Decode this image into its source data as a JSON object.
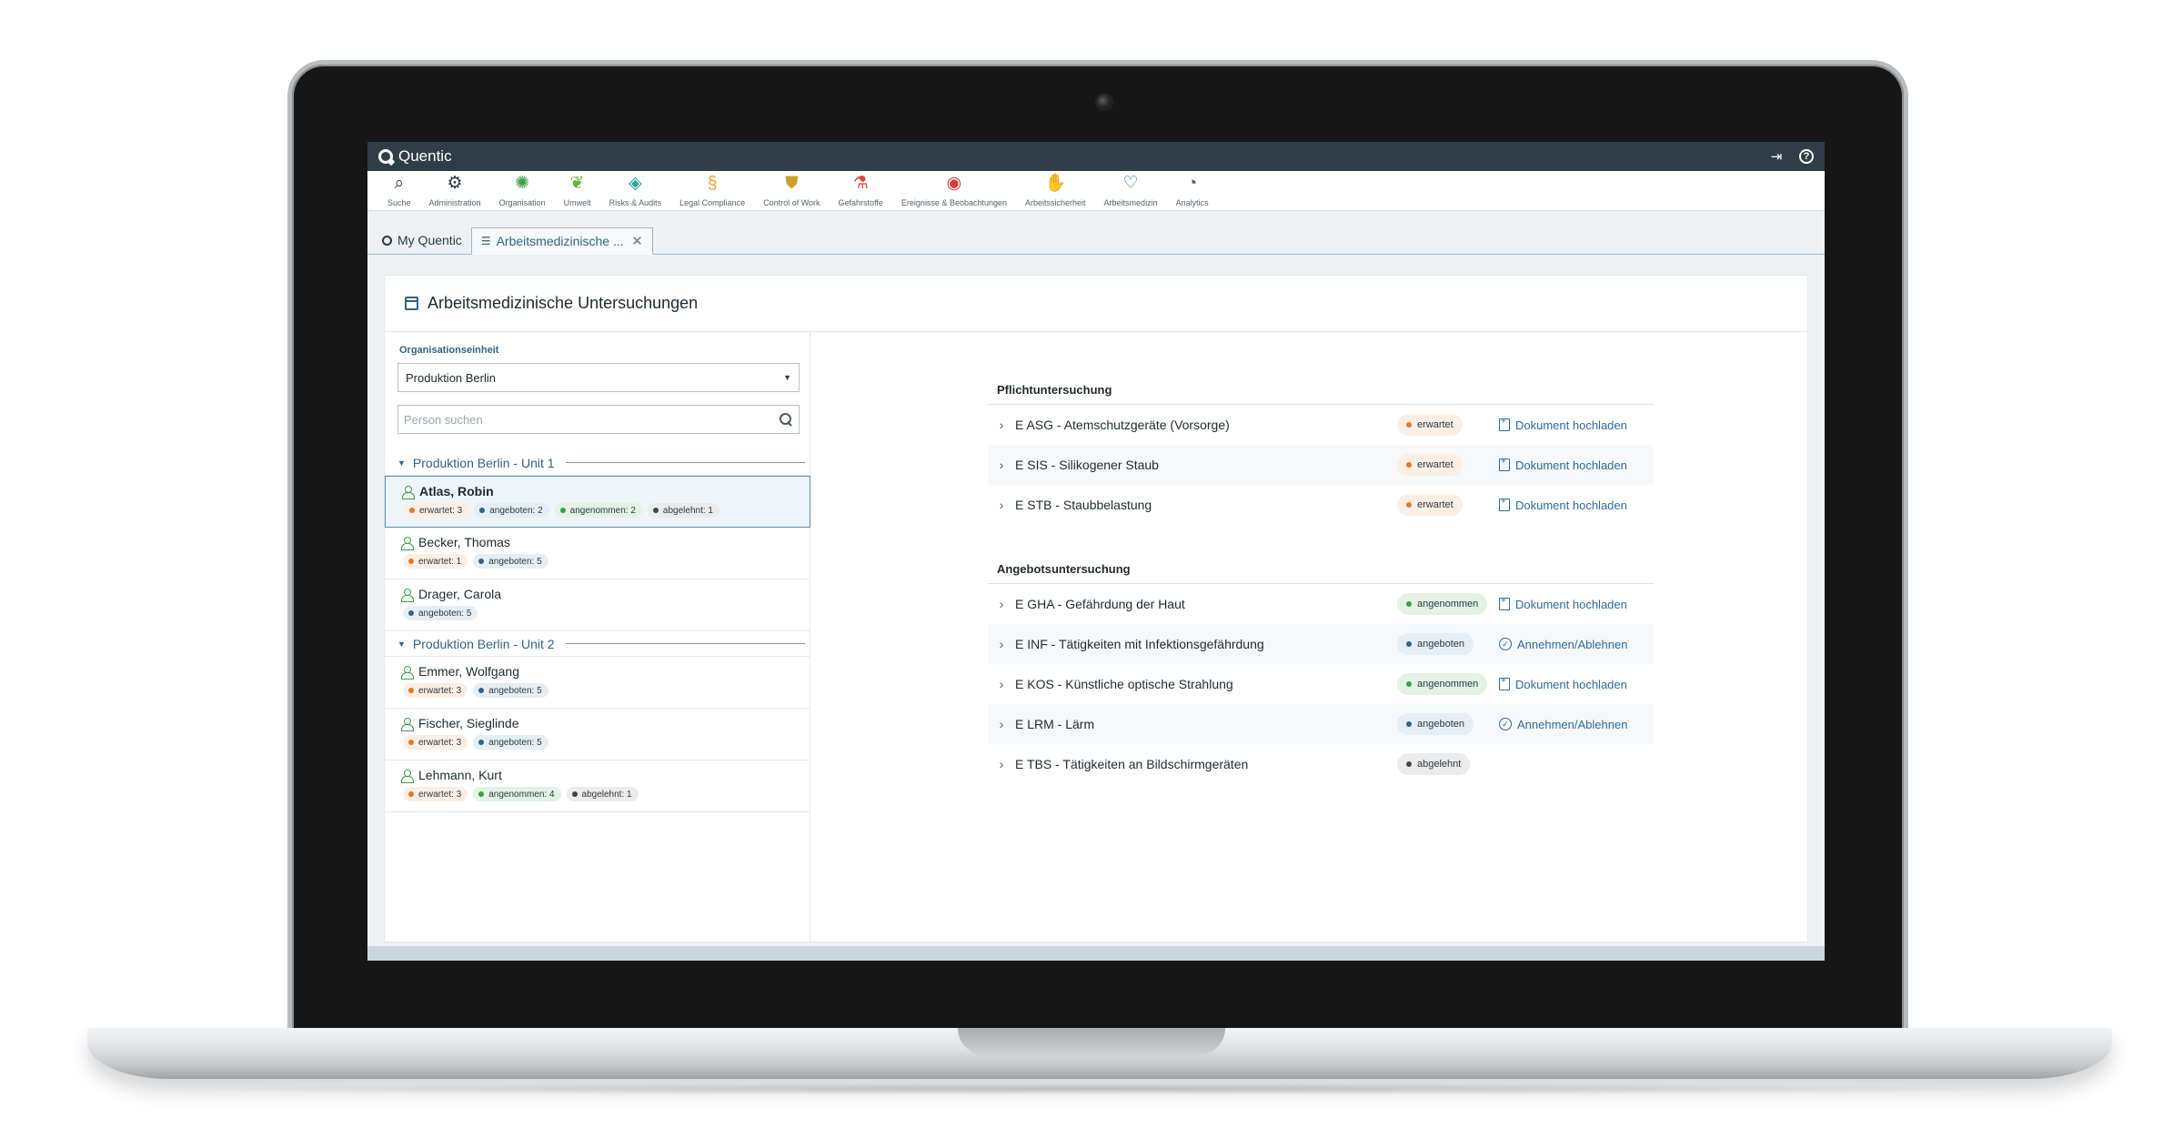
{
  "app": {
    "brand": "Quentic",
    "logout_icon": "logout-icon",
    "help_icon": "help-icon"
  },
  "modules": [
    {
      "label": "Suche",
      "icon": "⌕",
      "color": "#2b3a42",
      "name": "search"
    },
    {
      "label": "Administration",
      "icon": "⚙",
      "color": "#2b3a42",
      "name": "administration"
    },
    {
      "label": "Organisation",
      "icon": "✺",
      "color": "#39a047",
      "name": "organisation"
    },
    {
      "label": "Umwelt",
      "icon": "❦",
      "color": "#6fae3c",
      "name": "umwelt"
    },
    {
      "label": "Risks & Audits",
      "icon": "◈",
      "color": "#27a89a",
      "name": "risks-audits"
    },
    {
      "label": "Legal Compliance",
      "icon": "§",
      "color": "#f0a030",
      "name": "legal-compliance"
    },
    {
      "label": "Control of Work",
      "icon": "⛊",
      "color": "#c9a227",
      "name": "control-of-work"
    },
    {
      "label": "Gefahrstoffe",
      "icon": "⚗",
      "color": "#e0443a",
      "name": "gefahrstoffe"
    },
    {
      "label": "Ereignisse & Beobachtungen",
      "icon": "◉",
      "color": "#d63b3b",
      "name": "ereignisse"
    },
    {
      "label": "Arbeitssicherheit",
      "icon": "✋",
      "color": "#2f6aa1",
      "name": "arbeitssicherheit"
    },
    {
      "label": "Arbeitsmedizin",
      "icon": "♡",
      "color": "#2f6aa1",
      "name": "arbeitsmedizin"
    },
    {
      "label": "Analytics",
      "icon": "◔",
      "color": "#4b5a62",
      "name": "analytics"
    }
  ],
  "tabs": {
    "home": "My Quentic",
    "active": "Arbeitsmedizinische ..."
  },
  "panel": {
    "title": "Arbeitsmedizinische Untersuchungen",
    "org_label": "Organisationseinheit",
    "org_value": "Produktion Berlin",
    "search_placeholder": "Person suchen"
  },
  "groups": [
    {
      "title": "Produktion Berlin - Unit 1",
      "people": [
        {
          "name": "Atlas, Robin",
          "selected": true,
          "chips": [
            {
              "type": "erwartet",
              "text": "erwartet: 3"
            },
            {
              "type": "angeboten",
              "text": "angeboten: 2"
            },
            {
              "type": "angenommen",
              "text": "angenommen: 2"
            },
            {
              "type": "abgelehnt",
              "text": "abgelehnt: 1"
            }
          ]
        },
        {
          "name": "Becker, Thomas",
          "selected": false,
          "chips": [
            {
              "type": "erwartet",
              "text": "erwartet: 1"
            },
            {
              "type": "angeboten",
              "text": "angeboten: 5"
            }
          ]
        },
        {
          "name": "Drager, Carola",
          "selected": false,
          "chips": [
            {
              "type": "angeboten",
              "text": "angeboten: 5"
            }
          ]
        }
      ]
    },
    {
      "title": "Produktion Berlin - Unit 2",
      "people": [
        {
          "name": "Emmer, Wolfgang",
          "selected": false,
          "chips": [
            {
              "type": "erwartet",
              "text": "erwartet: 3"
            },
            {
              "type": "angeboten",
              "text": "angeboten: 5"
            }
          ]
        },
        {
          "name": "Fischer, Sieglinde",
          "selected": false,
          "chips": [
            {
              "type": "erwartet",
              "text": "erwartet: 3"
            },
            {
              "type": "angeboten",
              "text": "angeboten: 5"
            }
          ]
        },
        {
          "name": "Lehmann, Kurt",
          "selected": false,
          "chips": [
            {
              "type": "erwartet",
              "text": "erwartet: 3"
            },
            {
              "type": "angenommen",
              "text": "angenommen: 4"
            },
            {
              "type": "abgelehnt",
              "text": "abgelehnt: 1"
            }
          ]
        }
      ]
    }
  ],
  "sections": [
    {
      "title": "Pflichtuntersuchung",
      "rows": [
        {
          "label": "E ASG - Atemschutzgeräte (Vorsorge)",
          "status": "erwartet",
          "action": "Dokument hochladen",
          "action_type": "upload"
        },
        {
          "label": "E SIS - Silikogener Staub",
          "status": "erwartet",
          "action": "Dokument hochladen",
          "action_type": "upload"
        },
        {
          "label": "E STB - Staubbelastung",
          "status": "erwartet",
          "action": "Dokument hochladen",
          "action_type": "upload"
        }
      ]
    },
    {
      "title": "Angebotsuntersuchung",
      "rows": [
        {
          "label": "E GHA - Gefährdung der Haut",
          "status": "angenommen",
          "action": "Dokument hochladen",
          "action_type": "upload"
        },
        {
          "label": "E INF - Tätigkeiten mit Infektionsgefährdung",
          "status": "angeboten",
          "action": "Annehmen/Ablehnen",
          "action_type": "decide"
        },
        {
          "label": "E KOS - Künstliche optische Strahlung",
          "status": "angenommen",
          "action": "Dokument hochladen",
          "action_type": "upload"
        },
        {
          "label": "E LRM - Lärm",
          "status": "angeboten",
          "action": "Annehmen/Ablehnen",
          "action_type": "decide"
        },
        {
          "label": "E TBS - Tätigkeiten an Bildschirmgeräten",
          "status": "abgelehnt",
          "action": "",
          "action_type": ""
        }
      ]
    }
  ],
  "colors": {
    "topbar": "#2f3e46",
    "accent": "#35627f",
    "link": "#2f6aa1",
    "erwartet": "#e4772b",
    "angeboten": "#35627f",
    "angenommen": "#39a047",
    "abgelehnt": "#444444"
  }
}
